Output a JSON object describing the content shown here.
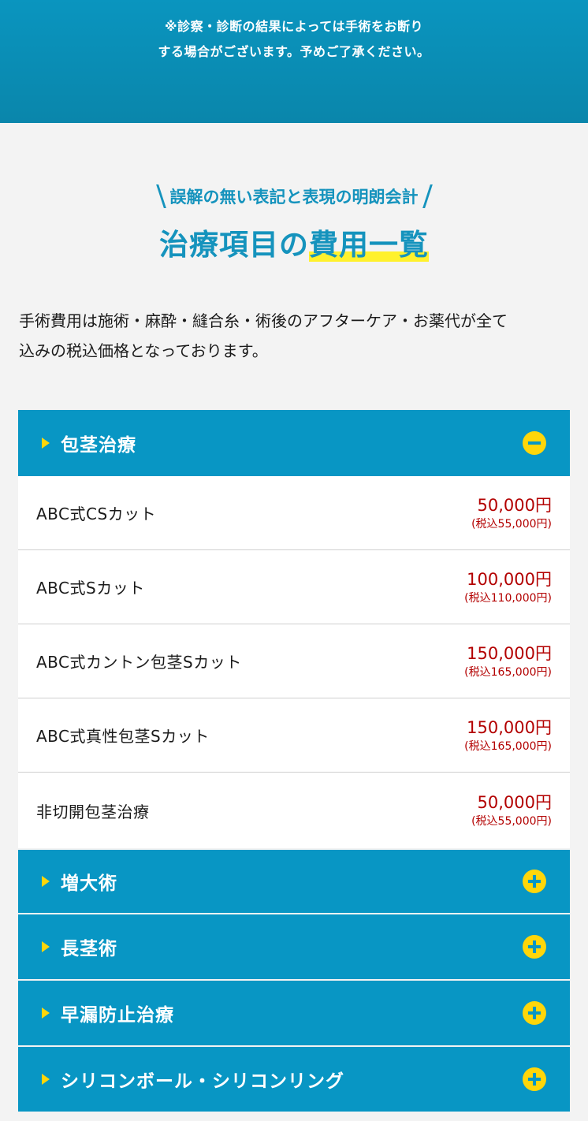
{
  "banner": {
    "line1": "※診察・診断の結果によっては手術をお断り",
    "line2": "する場合がございます。予めご了承ください。"
  },
  "heading": {
    "subcopy": "誤解の無い表記と表現の明朗会計",
    "title_a": "治療項目の",
    "title_b": "費用一覧"
  },
  "intro": {
    "line1": "手術費用は施術・麻酔・縫合糸・術後のアフターケア・お薬代が全て",
    "line2": "込みの税込価格となっております。"
  },
  "categories": [
    {
      "label": "包茎治療",
      "expanded": true,
      "items": [
        {
          "name": "ABC式CSカット",
          "price": "50,000円",
          "tax": "(税込55,000円)"
        },
        {
          "name": "ABC式Sカット",
          "price": "100,000円",
          "tax": "(税込110,000円)"
        },
        {
          "name": "ABC式カントン包茎Sカット",
          "price": "150,000円",
          "tax": "(税込165,000円)"
        },
        {
          "name": "ABC式真性包茎Sカット",
          "price": "150,000円",
          "tax": "(税込165,000円)"
        },
        {
          "name": "非切開包茎治療",
          "price": "50,000円",
          "tax": "(税込55,000円)"
        }
      ]
    },
    {
      "label": "増大術",
      "expanded": false
    },
    {
      "label": "長茎術",
      "expanded": false
    },
    {
      "label": "早漏防止治療",
      "expanded": false
    },
    {
      "label": "シリコンボール・シリコンリング",
      "expanded": false
    }
  ],
  "colors": {
    "primary": "#0896c4",
    "accent": "#ffd60a",
    "price": "#b30000"
  }
}
